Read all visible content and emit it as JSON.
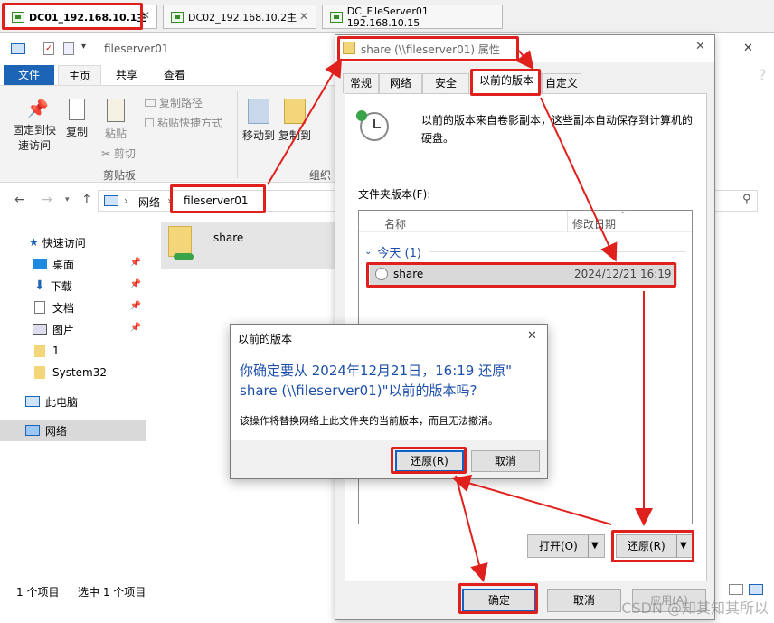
{
  "vm_tabs": [
    {
      "label": "DC01_192.168.10.1主",
      "active": true
    },
    {
      "label": "DC02_192.168.10.2主",
      "active": false
    },
    {
      "label": "DC_FileServer01 192.168.10.15",
      "active": false
    }
  ],
  "explorer": {
    "window_title": "fileserver01",
    "ribbon_tabs": [
      "文件",
      "主页",
      "共享",
      "查看"
    ],
    "ribbon": {
      "pin_label_line1": "固定到快",
      "pin_label_line2": "速访问",
      "copy_label": "复制",
      "paste_label": "粘贴",
      "copy_path": "复制路径",
      "paste_shortcut": "粘贴快捷方式",
      "cut": "剪切",
      "clipboard_group": "剪贴板",
      "move_to": "移动到",
      "copy_to": "复制到",
      "organize_group": "组织"
    },
    "address": {
      "root": "网络",
      "current": "fileserver01"
    },
    "nav": {
      "quick_access": "快速访问",
      "items": [
        {
          "label": "桌面",
          "pinned": true
        },
        {
          "label": "下载",
          "pinned": true
        },
        {
          "label": "文档",
          "pinned": true
        },
        {
          "label": "图片",
          "pinned": true
        },
        {
          "label": "1",
          "pinned": false
        },
        {
          "label": "System32",
          "pinned": false
        }
      ],
      "this_pc": "此电脑",
      "network": "网络"
    },
    "content_item": "share",
    "status": {
      "count": "1 个项目",
      "selected": "选中 1 个项目"
    }
  },
  "properties": {
    "title": "share (\\\\fileserver01) 属性",
    "tabs": [
      "常规",
      "网络",
      "安全",
      "以前的版本",
      "自定义"
    ],
    "active_tab": "以前的版本",
    "description_line1": "以前的版本来自卷影副本，这些副本自动保存到计算机的",
    "description_line2": "硬盘。",
    "folder_versions_label": "文件夹版本(F):",
    "columns": {
      "name": "名称",
      "modified": "修改日期"
    },
    "group": "今天 (1)",
    "row": {
      "name": "share",
      "date": "2024/12/21 16:19"
    },
    "open_button": "打开(O)",
    "restore_button": "还原(R)",
    "ok_button": "确定",
    "cancel_button": "取消",
    "apply_button": "应用(A)"
  },
  "confirm": {
    "title": "以前的版本",
    "question_line1": "你确定要从 2024年12月21日，16:19 还原\"",
    "question_line2": "share (\\\\fileserver01)\"以前的版本吗?",
    "detail": "该操作将替换网络上此文件夹的当前版本，而且无法撤消。",
    "restore_button": "还原(R)",
    "cancel_button": "取消"
  },
  "watermark": "CSDN @知其知其所以",
  "colors": {
    "accent": "#1c64b5",
    "annotation": "#e0201c",
    "link_blue": "#1e4fa8"
  }
}
